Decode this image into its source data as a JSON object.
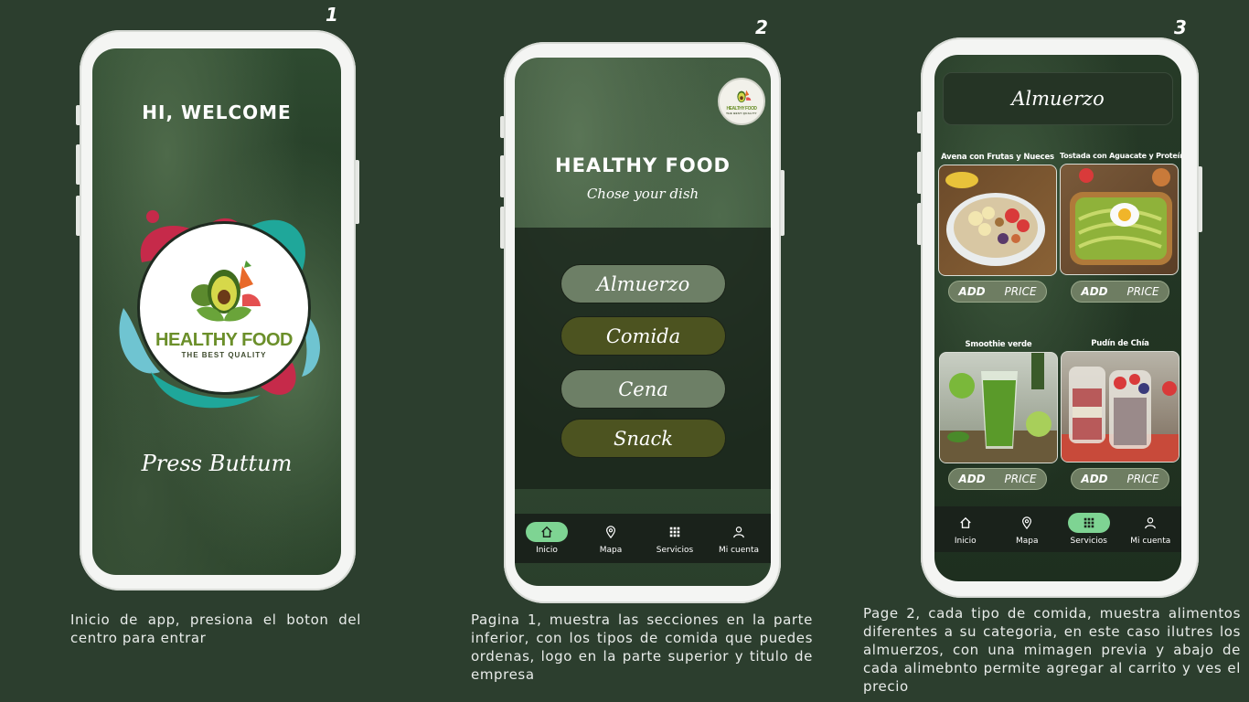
{
  "steps": [
    "1",
    "2",
    "3"
  ],
  "screen1": {
    "greeting": "HI, WELCOME",
    "logo_title": "HEALTHY FOOD",
    "logo_subtitle": "THE BEST QUALITY",
    "press_text": "Press Buttum",
    "caption": "Inicio de app, presiona el boton del centro para entrar"
  },
  "screen2": {
    "logo_title": "HEALTHY FOOD",
    "logo_subtitle": "THE BEST QUALITY",
    "title": "HEALTHY FOOD",
    "subtitle": "Chose your dish",
    "categories": [
      {
        "label": "Almuerzo",
        "style": "light"
      },
      {
        "label": "Comida",
        "style": "dark"
      },
      {
        "label": "Cena",
        "style": "light"
      },
      {
        "label": "Snack",
        "style": "dark"
      }
    ],
    "nav": [
      {
        "label": "Inicio",
        "icon": "home-icon",
        "active": true
      },
      {
        "label": "Mapa",
        "icon": "map-pin-icon",
        "active": false
      },
      {
        "label": "Servicios",
        "icon": "grid-icon",
        "active": false
      },
      {
        "label": "Mi cuenta",
        "icon": "user-icon",
        "active": false
      }
    ],
    "caption": "Pagina 1, muestra las secciones en la parte inferior, con los tipos de comida que puedes ordenas, logo en la parte superior y titulo de empresa"
  },
  "screen3": {
    "header": "Almuerzo",
    "dishes": [
      {
        "name": "Avena con Frutas y Nueces",
        "add": "ADD",
        "price": "PRICE"
      },
      {
        "name": "Tostada con Aguacate y Proteína",
        "add": "ADD",
        "price": "PRICE"
      },
      {
        "name": "Smoothie verde",
        "add": "ADD",
        "price": "PRICE"
      },
      {
        "name": "Pudín de Chía",
        "add": "ADD",
        "price": "PRICE"
      }
    ],
    "nav": [
      {
        "label": "Inicio",
        "icon": "home-icon",
        "active": false
      },
      {
        "label": "Mapa",
        "icon": "map-pin-icon",
        "active": false
      },
      {
        "label": "Servicios",
        "icon": "grid-icon",
        "active": true
      },
      {
        "label": "Mi cuenta",
        "icon": "user-icon",
        "active": false
      }
    ],
    "caption": "Page 2, cada tipo de comida, muestra alimentos diferentes a su categoria, en este caso ilutres los almuerzos, con una mimagen previa y abajo de cada alimebnto permite agregar al carrito y ves el precio"
  },
  "colors": {
    "background": "#2c3e2e",
    "nav_active": "#7ed493",
    "category_light": "#6d7f66",
    "category_dark": "#4c5320"
  }
}
